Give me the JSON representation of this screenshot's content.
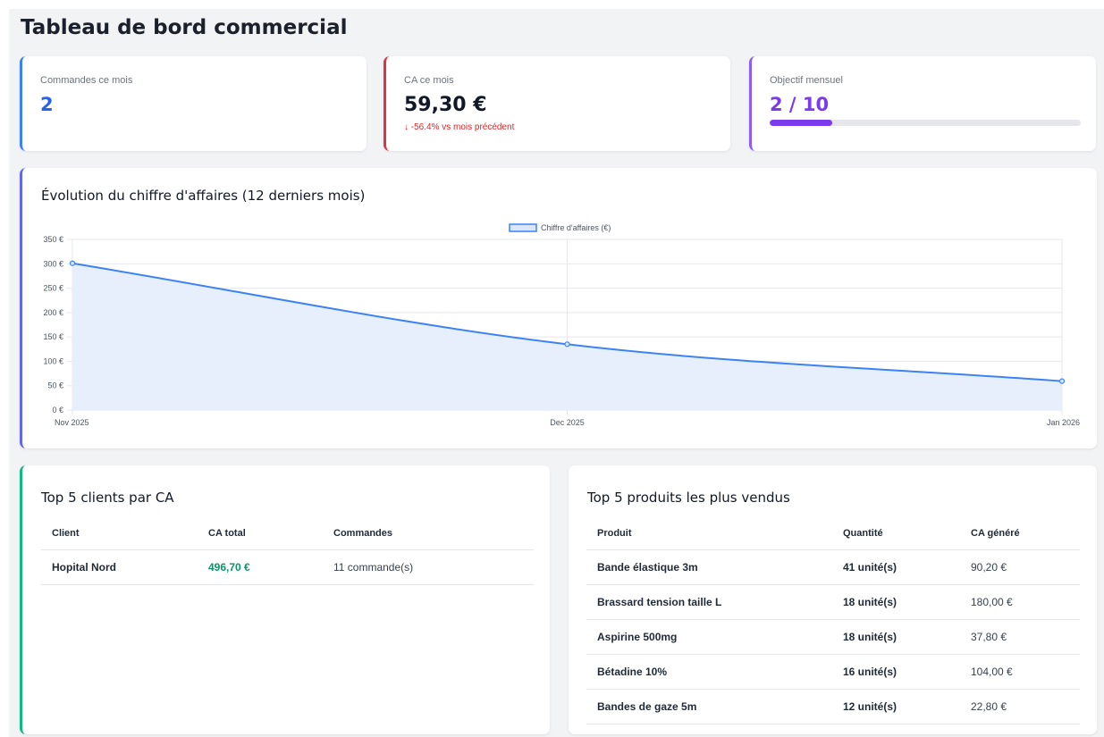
{
  "page": {
    "title": "Tableau de bord commercial"
  },
  "kpis": {
    "orders": {
      "label": "Commandes ce mois",
      "value": "2"
    },
    "revenue": {
      "label": "CA ce mois",
      "value": "59,30 €",
      "delta": "↓ -56.4% vs mois précédent",
      "delta_color": "#dc2626"
    },
    "goal": {
      "label": "Objectif mensuel",
      "value": "2 / 10",
      "progress_fraction": 0.2
    }
  },
  "chart": {
    "title": "Évolution du chiffre d'affaires (12 derniers mois)"
  },
  "chart_data": {
    "type": "area",
    "categories": [
      "Nov 2025",
      "Dec 2025",
      "Jan 2026"
    ],
    "series": [
      {
        "name": "Chiffre d'affaires (€)",
        "values": [
          301,
          135,
          59.3
        ],
        "color": "#3b82f6",
        "fill": "#e8effc"
      }
    ],
    "ylim": [
      0,
      350
    ],
    "yticks": [
      "0 €",
      "50 €",
      "100 €",
      "150 €",
      "200 €",
      "250 €",
      "300 €",
      "350 €"
    ],
    "legend_position": "top-center",
    "grid": true
  },
  "clients": {
    "title": "Top 5 clients par CA",
    "headers": [
      "Client",
      "CA total",
      "Commandes"
    ],
    "rows": [
      {
        "client": "Hopital Nord",
        "total": "496,70 €",
        "orders": "11 commande(s)"
      }
    ]
  },
  "products": {
    "title": "Top 5 produits les plus vendus",
    "headers": [
      "Produit",
      "Quantité",
      "CA généré"
    ],
    "rows": [
      {
        "product": "Bande élastique 3m",
        "qty": "41 unité(s)",
        "revenue": "90,20 €"
      },
      {
        "product": "Brassard tension taille L",
        "qty": "18 unité(s)",
        "revenue": "180,00 €"
      },
      {
        "product": "Aspirine 500mg",
        "qty": "18 unité(s)",
        "revenue": "37,80 €"
      },
      {
        "product": "Bétadine 10%",
        "qty": "16 unité(s)",
        "revenue": "104,00 €"
      },
      {
        "product": "Bandes de gaze 5m",
        "qty": "12 unité(s)",
        "revenue": "22,80 €"
      }
    ]
  }
}
